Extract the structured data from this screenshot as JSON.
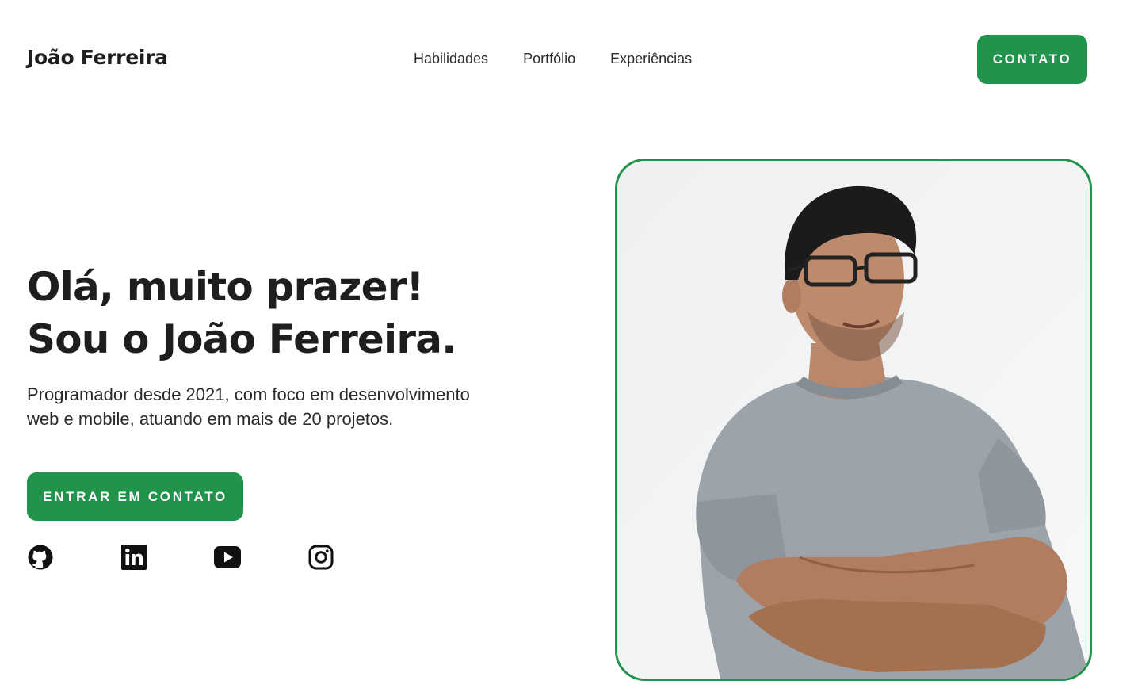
{
  "header": {
    "brand": "João Ferreira",
    "nav": [
      {
        "label": "Habilidades"
      },
      {
        "label": "Portfólio"
      },
      {
        "label": "Experiências"
      }
    ],
    "cta_label": "CONTATO"
  },
  "hero": {
    "title_line1": "Olá, muito prazer!",
    "title_line2": "Sou o João Ferreira.",
    "description": "Programador desde 2021, com foco em desenvolvimento web e mobile, atuando em mais de 20 projetos.",
    "cta_label": "ENTRAR EM CONTATO",
    "socials": [
      {
        "icon": "github-icon"
      },
      {
        "icon": "linkedin-icon"
      },
      {
        "icon": "youtube-icon"
      },
      {
        "icon": "instagram-icon"
      }
    ]
  },
  "photo": {
    "subject": "portrait"
  },
  "colors": {
    "accent": "#21934b",
    "text": "#1e1e1e",
    "background": "#ffffff"
  }
}
